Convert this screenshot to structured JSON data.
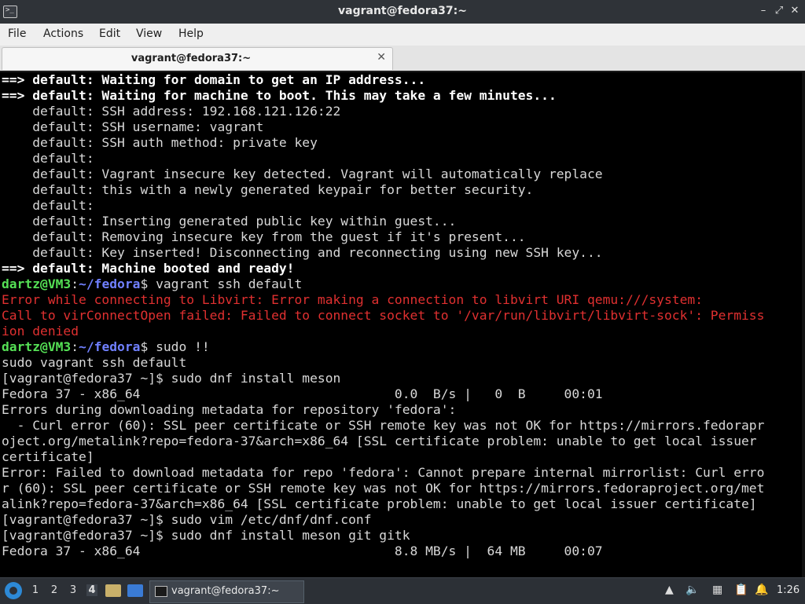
{
  "window": {
    "title": "vagrant@fedora37:~",
    "app_icon": "terminal-icon",
    "controls": [
      "minimize-icon",
      "maximize-icon",
      "close-icon"
    ]
  },
  "menu": {
    "items": [
      "File",
      "Actions",
      "Edit",
      "View",
      "Help"
    ]
  },
  "tabs": [
    {
      "label": "vagrant@fedora37:~"
    }
  ],
  "terminal": {
    "lines": [
      [
        {
          "t": "==> default: Waiting for domain to get an IP address...",
          "c": "bold"
        }
      ],
      [
        {
          "t": "==> default: Waiting for machine to boot. This may take a few minutes...",
          "c": "bold"
        }
      ],
      [
        {
          "t": "    default: SSH address: 192.168.121.126:22",
          "c": "normal"
        }
      ],
      [
        {
          "t": "    default: SSH username: vagrant",
          "c": "normal"
        }
      ],
      [
        {
          "t": "    default: SSH auth method: private key",
          "c": "normal"
        }
      ],
      [
        {
          "t": "    default:",
          "c": "normal"
        }
      ],
      [
        {
          "t": "    default: Vagrant insecure key detected. Vagrant will automatically replace",
          "c": "normal"
        }
      ],
      [
        {
          "t": "    default: this with a newly generated keypair for better security.",
          "c": "normal"
        }
      ],
      [
        {
          "t": "    default:",
          "c": "normal"
        }
      ],
      [
        {
          "t": "    default: Inserting generated public key within guest...",
          "c": "normal"
        }
      ],
      [
        {
          "t": "    default: Removing insecure key from the guest if it's present...",
          "c": "normal"
        }
      ],
      [
        {
          "t": "    default: Key inserted! Disconnecting and reconnecting using new SSH key...",
          "c": "normal"
        }
      ],
      [
        {
          "t": "==> default: Machine booted and ready!",
          "c": "bold"
        }
      ],
      [
        {
          "t": "dartz@VM3",
          "c": "green"
        },
        {
          "t": ":",
          "c": "normal"
        },
        {
          "t": "~/fedora",
          "c": "blue"
        },
        {
          "t": "$ vagrant ssh default",
          "c": "normal"
        }
      ],
      [
        {
          "t": "Error while connecting to Libvirt: Error making a connection to libvirt URI qemu:///system:",
          "c": "red"
        }
      ],
      [
        {
          "t": "Call to virConnectOpen failed: Failed to connect socket to '/var/run/libvirt/libvirt-sock': Permiss",
          "c": "red"
        }
      ],
      [
        {
          "t": "ion denied",
          "c": "red"
        }
      ],
      [
        {
          "t": "dartz@VM3",
          "c": "green"
        },
        {
          "t": ":",
          "c": "normal"
        },
        {
          "t": "~/fedora",
          "c": "blue"
        },
        {
          "t": "$ sudo !!",
          "c": "normal"
        }
      ],
      [
        {
          "t": "sudo vagrant ssh default",
          "c": "normal"
        }
      ],
      [
        {
          "t": "[vagrant@fedora37 ~]$ sudo dnf install meson",
          "c": "normal"
        }
      ],
      [
        {
          "t": "Fedora 37 - x86_64                                 0.0  B/s |   0  B     00:01",
          "c": "normal"
        }
      ],
      [
        {
          "t": "Errors during downloading metadata for repository 'fedora':",
          "c": "normal"
        }
      ],
      [
        {
          "t": "  - Curl error (60): SSL peer certificate or SSH remote key was not OK for https://mirrors.fedorapr",
          "c": "normal"
        }
      ],
      [
        {
          "t": "oject.org/metalink?repo=fedora-37&arch=x86_64 [SSL certificate problem: unable to get local issuer",
          "c": "normal"
        }
      ],
      [
        {
          "t": "certificate]",
          "c": "normal"
        }
      ],
      [
        {
          "t": "Error: Failed to download metadata for repo 'fedora': Cannot prepare internal mirrorlist: Curl erro",
          "c": "normal"
        }
      ],
      [
        {
          "t": "r (60): SSL peer certificate or SSH remote key was not OK for https://mirrors.fedoraproject.org/met",
          "c": "normal"
        }
      ],
      [
        {
          "t": "alink?repo=fedora-37&arch=x86_64 [SSL certificate problem: unable to get local issuer certificate]",
          "c": "normal"
        }
      ],
      [
        {
          "t": "[vagrant@fedora37 ~]$ sudo vim /etc/dnf/dnf.conf",
          "c": "normal"
        }
      ],
      [
        {
          "t": "[vagrant@fedora37 ~]$ sudo dnf install meson git gitk",
          "c": "normal"
        }
      ],
      [
        {
          "t": "Fedora 37 - x86_64                                 8.8 MB/s |  64 MB     00:07",
          "c": "normal"
        }
      ]
    ]
  },
  "taskbar": {
    "workspaces": [
      "1",
      "2",
      "3",
      "4"
    ],
    "active_workspace": "4",
    "task_label": "vagrant@fedora37:~",
    "tray_icons": [
      "upload-icon",
      "volume-icon",
      "network-icon",
      "clipboard-icon",
      "notification-icon"
    ],
    "clock": "1:26"
  }
}
